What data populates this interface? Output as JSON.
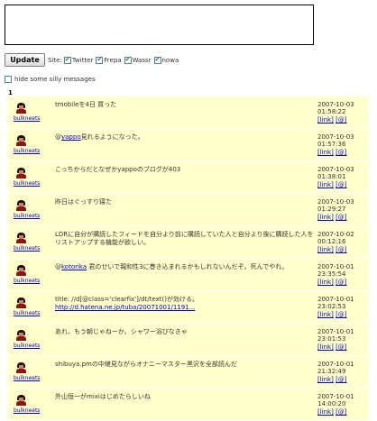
{
  "compose": {
    "value": ""
  },
  "toolbar": {
    "update_label": "Update",
    "site_label": "Site:",
    "sites": [
      {
        "label": "Twitter",
        "checked": true
      },
      {
        "label": "Frepa",
        "checked": true
      },
      {
        "label": "Wassr",
        "checked": true
      },
      {
        "label": "nowa",
        "checked": true
      }
    ]
  },
  "filter": {
    "hide_label": "hide some silly messages",
    "checked": false
  },
  "page_number": "1",
  "messages": [
    {
      "user": "bulkneets",
      "text": "tmobileを4日 買った",
      "date": "2007-10-03",
      "time": "01:58:22",
      "link_label": "[link]",
      "reply_label": "[@]"
    },
    {
      "user": "bulkneets",
      "text_prefix": "@",
      "text_link": "yappo",
      "text": "見れるようになった。",
      "date": "2007-10-03",
      "time": "01:57:36",
      "link_label": "[link]",
      "reply_label": "[@]"
    },
    {
      "user": "bulkneets",
      "text": "こっちからだとなぜかyappoのブログが403",
      "date": "2007-10-03",
      "time": "01:38:01",
      "link_label": "[link]",
      "reply_label": "[@]"
    },
    {
      "user": "bulkneets",
      "text": "昨日はぐっすり寝た",
      "date": "2007-10-03",
      "time": "01:29:27",
      "link_label": "[link]",
      "reply_label": "[@]"
    },
    {
      "user": "bulkneets",
      "text": "LDRに自分が購読したフィードを自分より前に購読していた人と自分より後に購読した人をリストアップする機能が欲しい。",
      "date": "2007-10-02",
      "time": "00:12:16",
      "link_label": "[link]",
      "reply_label": "[@]"
    },
    {
      "user": "bulkneets",
      "text_prefix": "@",
      "text_link": "kotorika",
      "text": " 君のせいで親和性3に巻き込まれるかもしれないんだぞ。死んでやれ。",
      "date": "2007-10-01",
      "time": "23:35:54",
      "link_label": "[link]",
      "reply_label": "[@]"
    },
    {
      "user": "bulkneets",
      "text": "title: //d[@class='clearfix']/dt/text()が効ける。",
      "text_url": "http://d.hatena.ne.jp/tuba/20071001/1191...",
      "date": "2007-10-01",
      "time": "23:02:53",
      "link_label": "[link]",
      "reply_label": "[@]"
    },
    {
      "user": "bulkneets",
      "text": "あれ、もう朝じゃねーか。シャワー浴びなきゃ",
      "date": "2007-10-01",
      "time": "23:01:53",
      "link_label": "[link]",
      "reply_label": "[@]"
    },
    {
      "user": "bulkneets",
      "text": "shibuya.pmの中継見ながらオナニーマスター黒沢を全部読んだ",
      "date": "2007-10-01",
      "time": "21:32:49",
      "link_label": "[link]",
      "reply_label": "[@]"
    },
    {
      "user": "bulkneets",
      "text": "外山恒一がmixiはじめたらしいね",
      "date": "2007-10-01",
      "time": "14:00:20",
      "link_label": "[link]",
      "reply_label": "[@]"
    }
  ]
}
